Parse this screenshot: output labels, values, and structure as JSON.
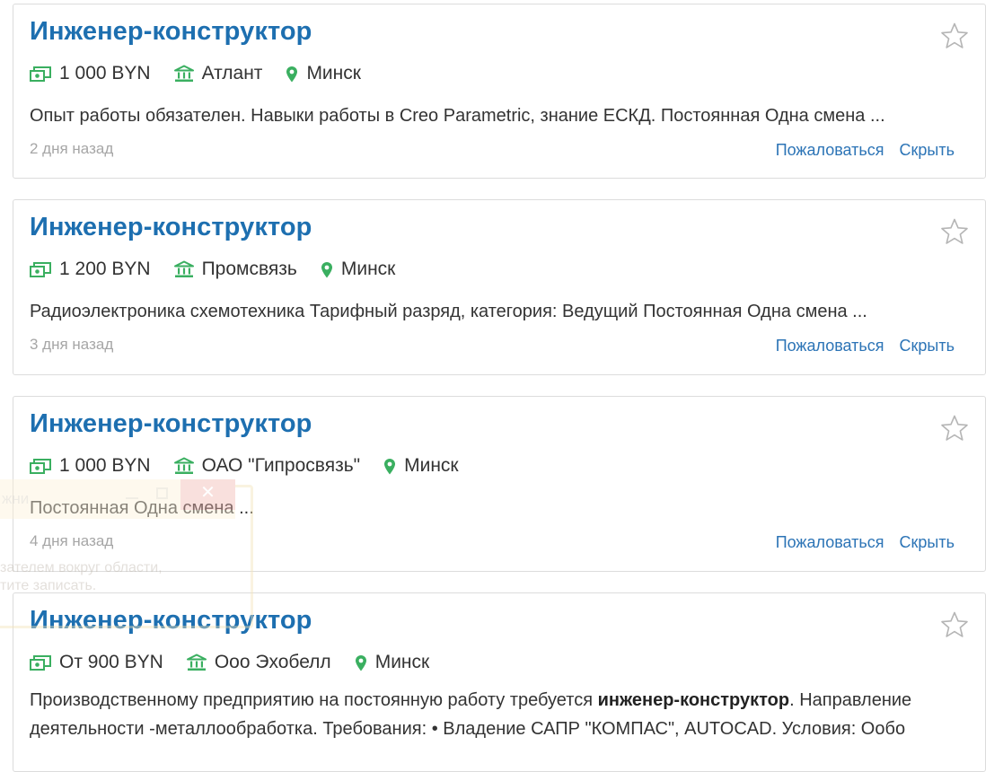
{
  "colors": {
    "title": "#1d6fb0",
    "link": "#2c74b6",
    "icon": "#3aaf60",
    "date": "#a6a6a6"
  },
  "icons": {
    "salary": "money-icon",
    "company": "company-building-icon",
    "location": "location-pin-icon",
    "favorite": "star-icon"
  },
  "vacancies": [
    {
      "title": "Инженер-конструктор",
      "salary": "1 000 BYN",
      "company": "Атлант",
      "city": "Минск",
      "description": "Опыт работы обязателен. Навыки работы в Creo Parametric, знание ЕСКД. Постоянная Одна смена ...",
      "date": "2 дня назад",
      "report_label": "Пожаловаться",
      "hide_label": "Скрыть"
    },
    {
      "title": "Инженер-конструктор",
      "salary": "1 200 BYN",
      "company": "Промсвязь",
      "city": "Минск",
      "description": "Радиоэлектроника схемотехника Тарифный разряд, категория: Ведущий Постоянная Одна смена ...",
      "date": "3 дня назад",
      "report_label": "Пожаловаться",
      "hide_label": "Скрыть"
    },
    {
      "title": "Инженер-конструктор",
      "salary": "1 000 BYN",
      "company": "ОАО \"Гипросвязь\"",
      "city": "Минск",
      "description": "Постоянная Одна смена ...",
      "date": "4 дня назад",
      "report_label": "Пожаловаться",
      "hide_label": "Скрыть"
    },
    {
      "title": "Инженер-конструктор",
      "salary": "От 900 BYN",
      "company": "Ооо Эхобелл",
      "city": "Минск",
      "description_pre": "Производственному предприятию на постоянную работу требуется ",
      "description_bold": "инженер-конструктор",
      "description_post": ". Направление деятельности -металлообработка. Требования: • Владение САПР \"КОМПАС\", AUTOCAD. Условия: Ообо"
    }
  ],
  "overlay": {
    "title_fragment": "жни",
    "close_glyph": "✕",
    "line1": "зателем вокруг области,",
    "line2": "тите записать."
  }
}
